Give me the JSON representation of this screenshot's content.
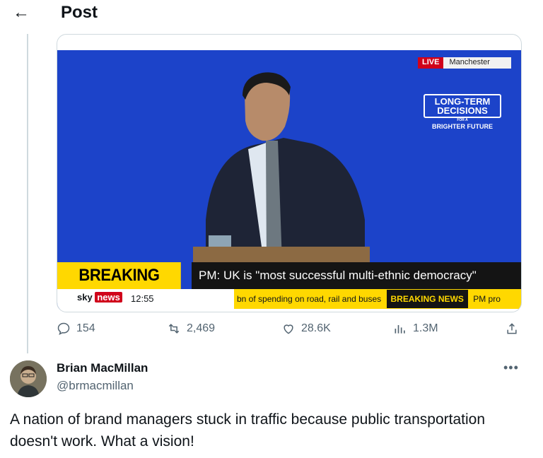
{
  "header": {
    "back_icon": "←",
    "title": "Post"
  },
  "video": {
    "live_label": "LIVE",
    "location": "Manchester",
    "slogan": {
      "line1": "LONG-TERM",
      "line2": "DECISIONS",
      "line3": "FOR A",
      "line4": "BRIGHTER FUTURE"
    },
    "breaking_label": "BREAKING NEWS",
    "headline": "PM: UK is \"most successful multi-ethnic democracy\"",
    "brand_sky": "sky",
    "brand_news": "news",
    "clock": "12:55",
    "ticker_items": [
      "bn of spending on road, rail and buses",
      "BREAKING NEWS",
      "PM pro"
    ]
  },
  "stats": {
    "replies": "154",
    "reposts": "2,469",
    "likes": "28.6K",
    "views": "1.3M"
  },
  "reply": {
    "name": "Brian MacMillan",
    "handle": "@brmacmillan",
    "more": "•••",
    "text": "A nation of brand managers stuck in traffic because public transportation doesn't work. What a vision!"
  },
  "colors": {
    "accent_blue": "#1c43c9",
    "breaking_yellow": "#ffd800",
    "live_red": "#d0021b",
    "muted": "#536471"
  }
}
